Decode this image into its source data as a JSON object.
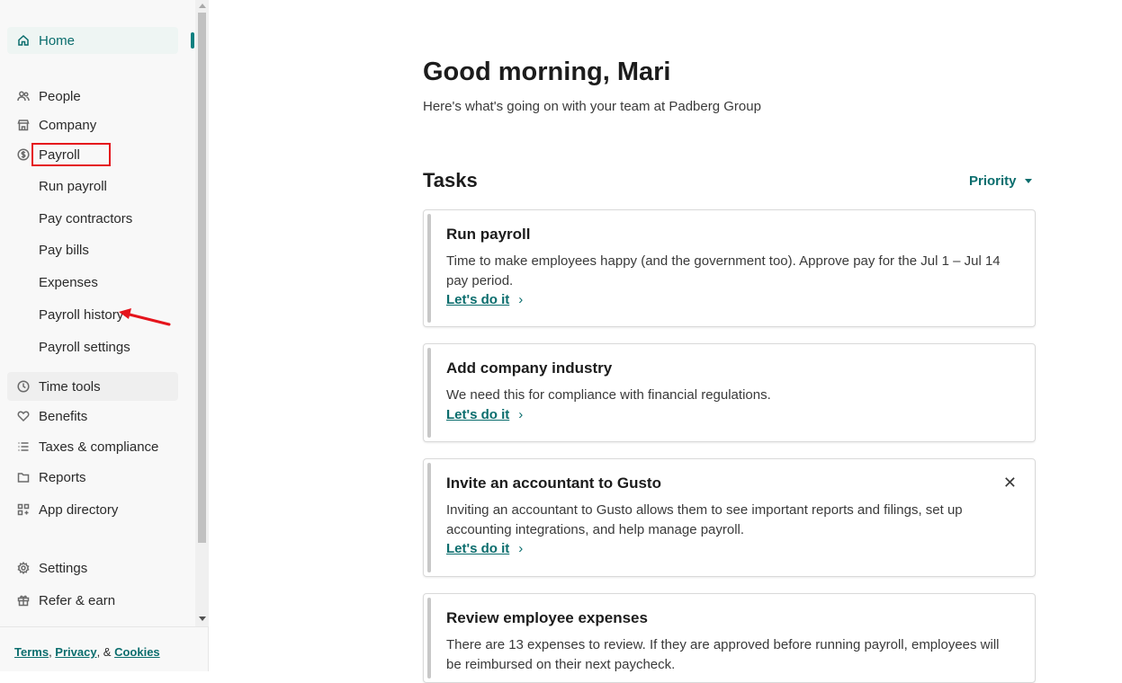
{
  "sidebar": {
    "items": {
      "home": "Home",
      "people": "People",
      "company": "Company",
      "payroll": "Payroll",
      "time_tools": "Time tools",
      "benefits": "Benefits",
      "taxes": "Taxes & compliance",
      "reports": "Reports",
      "app_directory": "App directory",
      "settings": "Settings",
      "refer": "Refer & earn"
    },
    "payroll_sub": {
      "run": "Run payroll",
      "contractors": "Pay contractors",
      "bills": "Pay bills",
      "expenses": "Expenses",
      "history": "Payroll history",
      "settings": "Payroll settings"
    },
    "footer": {
      "terms": "Terms",
      "sep1": ", ",
      "privacy": "Privacy",
      "sep2": ", & ",
      "cookies": "Cookies"
    }
  },
  "main": {
    "greeting": "Good morning, Mari",
    "subtext": "Here's what's going on with your team at Padberg Group",
    "tasks_title": "Tasks",
    "priority_label": "Priority",
    "cards": [
      {
        "title": "Run payroll",
        "desc": "Time to make employees happy (and the government too). Approve pay for the Jul 1 – Jul 14 pay period.",
        "link": "Let's do it"
      },
      {
        "title": "Add company industry",
        "desc": "We need this for compliance with financial regulations.",
        "link": "Let's do it"
      },
      {
        "title": "Invite an accountant to Gusto",
        "desc": "Inviting an accountant to Gusto allows them to see important reports and filings, set up accounting integrations, and help manage payroll.",
        "link": "Let's do it"
      },
      {
        "title": "Review employee expenses",
        "desc": "There are 13 expenses to review. If they are approved before running payroll, employees will be reimbursed on their next paycheck."
      }
    ]
  },
  "colors": {
    "accent": "#0a6d6d",
    "annotation": "#e5141c"
  }
}
